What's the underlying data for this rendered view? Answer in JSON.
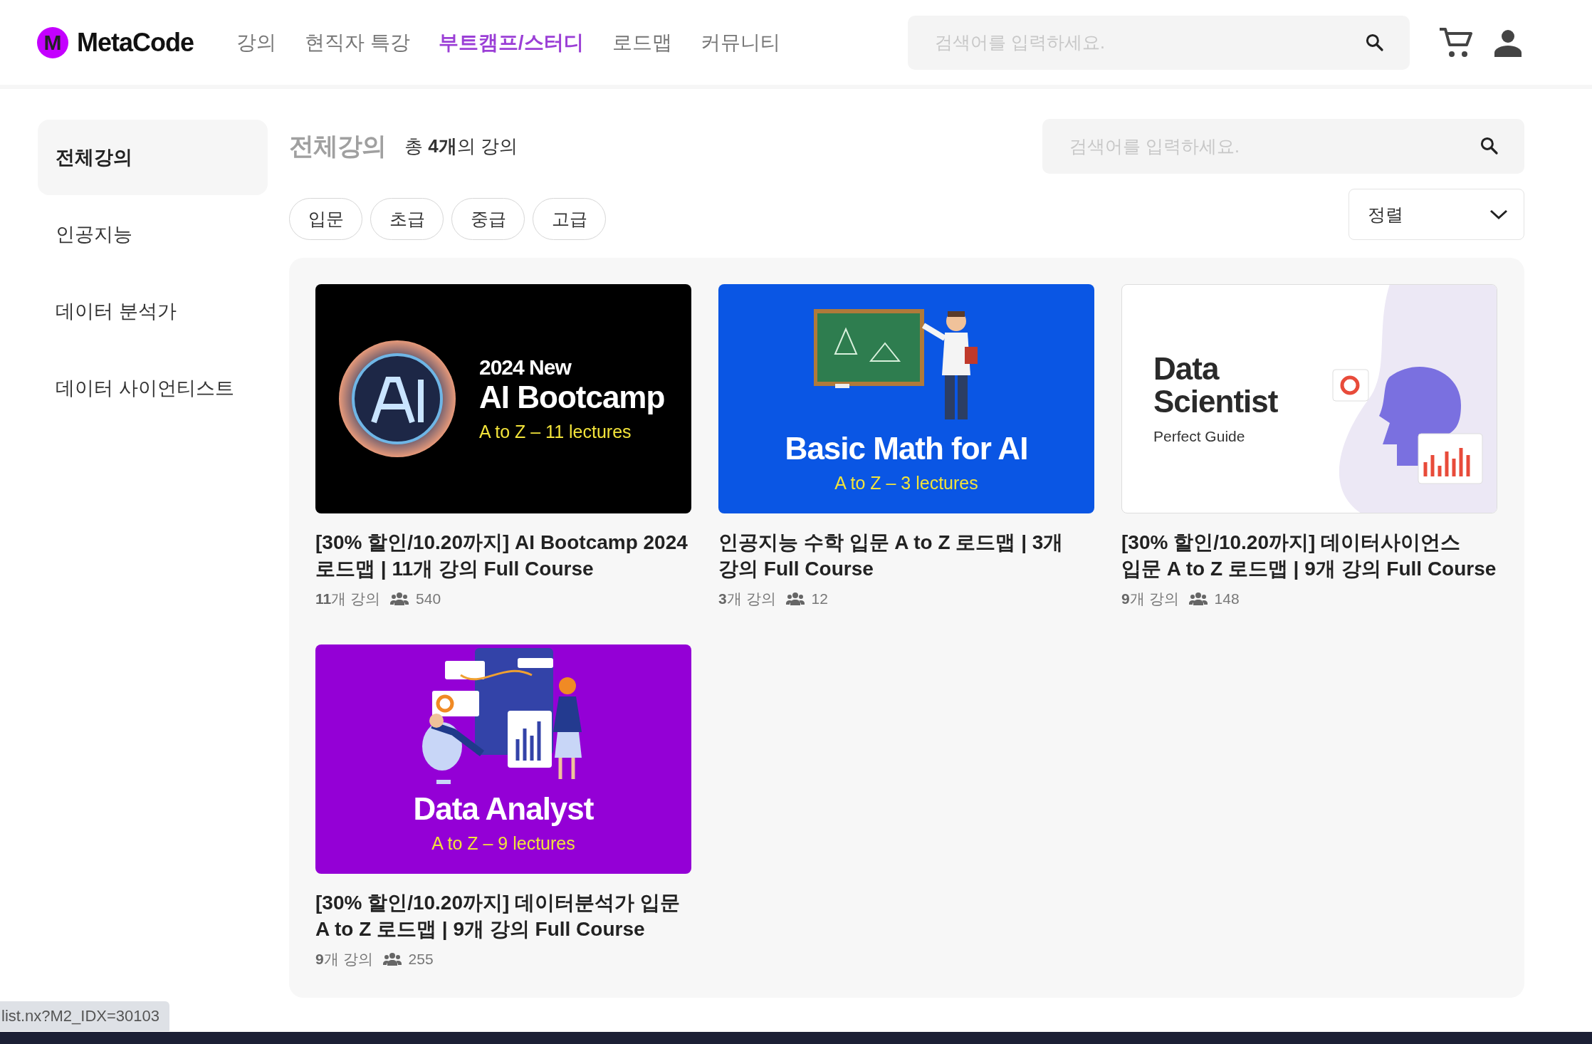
{
  "header": {
    "logo": {
      "mark": "M",
      "name": "MetaCode"
    },
    "nav": [
      {
        "label": "강의",
        "selected": false
      },
      {
        "label": "현직자 특강",
        "selected": false
      },
      {
        "label": "부트캠프/스터디",
        "selected": true
      },
      {
        "label": "로드맵",
        "selected": false
      },
      {
        "label": "커뮤니티",
        "selected": false
      }
    ],
    "search": {
      "placeholder": "검색어를 입력하세요."
    }
  },
  "sidebar": {
    "items": [
      {
        "label": "전체강의",
        "selected": true
      },
      {
        "label": "인공지능",
        "selected": false
      },
      {
        "label": "데이터 분석가",
        "selected": false
      },
      {
        "label": "데이터 사이언티스트",
        "selected": false
      }
    ]
  },
  "main": {
    "title": "전체강의",
    "count": "총 **4개**의 강의",
    "search": {
      "placeholder": "검색어를 입력하세요."
    },
    "filters": [
      {
        "label": "입문",
        "selected": false
      },
      {
        "label": "초급",
        "selected": false
      },
      {
        "label": "중급",
        "selected": false
      },
      {
        "label": "고급",
        "selected": false
      }
    ],
    "sort": {
      "label": "정렬"
    },
    "courses": [
      {
        "thumbnail": {
          "kind": "dark",
          "kicker": "2024 New",
          "title": "AI Bootcamp",
          "subtitle": "A to Z – 11 lectures"
        },
        "title": "[30% 할인/10.20까지] AI Bootcamp 2024 로드맵 | 11개 강의 Full Course",
        "lectures": "**11**개 강의",
        "students": "540"
      },
      {
        "thumbnail": {
          "kind": "blue",
          "title": "Basic Math for AI",
          "subtitle": "A to Z – 3 lectures"
        },
        "title": "인공지능 수학 입문 A to Z 로드맵 | 3개 강의 Full Course",
        "lectures": "**3**개 강의",
        "students": "12"
      },
      {
        "thumbnail": {
          "kind": "light",
          "title": "Data Scientist",
          "subtitle": "Perfect Guide"
        },
        "title": "[30% 할인/10.20까지] 데이터사이언스 입문 A to Z 로드맵 | 9개 강의 Full Course",
        "lectures": "**9**개 강의",
        "students": "148"
      },
      {
        "thumbnail": {
          "kind": "purple",
          "title": "Data Analyst",
          "subtitle": "A to Z – 9 lectures"
        },
        "title": "[30% 할인/10.20까지] 데이터분석가 입문 A to Z 로드맵 | 9개 강의 Full Course",
        "lectures": "**9**개 강의",
        "students": "255"
      }
    ]
  },
  "status_url": "list.nx?M2_IDX=30103"
}
